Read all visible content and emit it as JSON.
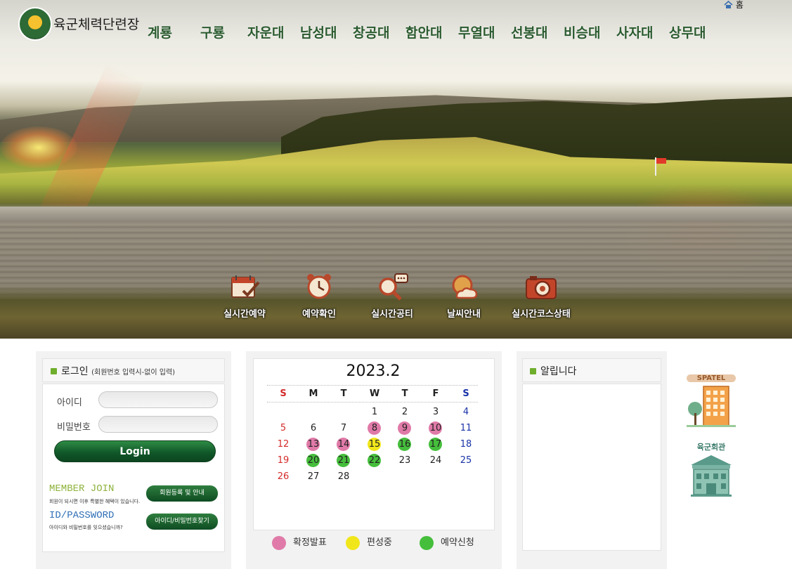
{
  "header": {
    "site_name": "육군체력단련장",
    "home_label": "홈",
    "nav": [
      "계룡",
      "구룡",
      "자운대",
      "남성대",
      "창공대",
      "함안대",
      "무열대",
      "선봉대",
      "비승대",
      "사자대",
      "상무대"
    ]
  },
  "quick_links": [
    {
      "label": "실시간예약",
      "icon": "calendar-check-icon"
    },
    {
      "label": "예약확인",
      "icon": "alarm-clock-icon"
    },
    {
      "label": "실시간공티",
      "icon": "search-chat-icon"
    },
    {
      "label": "날씨안내",
      "icon": "weather-icon"
    },
    {
      "label": "실시간코스상태",
      "icon": "camera-icon"
    }
  ],
  "login": {
    "title": "로그인",
    "subtitle": "(회원번호 입력시-없이 입력)",
    "id_label": "아이디",
    "pw_label": "비밀번호",
    "login_button": "Login",
    "member_join_title": "MEMBER JOIN",
    "member_join_desc": "회원이 되시면 이후 특별한 혜택이 있습니다.",
    "member_join_button": "회원등록 및 안내",
    "idpw_title": "ID/PASSWORD",
    "idpw_desc": "아이디와 비밀번호를 잊으셨습니까?",
    "idpw_button": "아이디/비밀번호찾기"
  },
  "calendar": {
    "title": "2023.2",
    "weekdays": [
      "S",
      "M",
      "T",
      "W",
      "T",
      "F",
      "S"
    ],
    "weeks": [
      [
        "",
        "",
        "",
        "1",
        "2",
        "3",
        "4"
      ],
      [
        "5",
        "6",
        "7",
        "8",
        "9",
        "10",
        "11"
      ],
      [
        "12",
        "13",
        "14",
        "15",
        "16",
        "17",
        "18"
      ],
      [
        "19",
        "20",
        "21",
        "22",
        "23",
        "24",
        "25"
      ],
      [
        "26",
        "27",
        "28",
        "",
        "",
        "",
        ""
      ]
    ],
    "marks": {
      "8": "confirmed",
      "9": "confirmed",
      "10": "confirmed",
      "13": "confirmed",
      "14": "confirmed",
      "15": "organizing",
      "16": "reservation",
      "17": "reservation",
      "20": "reservation",
      "21": "reservation",
      "22": "reservation"
    },
    "legend": [
      {
        "key": "confirmed",
        "label": "확정발표",
        "color": "#e07aa8"
      },
      {
        "key": "organizing",
        "label": "편성중",
        "color": "#f1e61a"
      },
      {
        "key": "reservation",
        "label": "예약신청",
        "color": "#45be3c"
      }
    ],
    "colors": {
      "sunday": "#d42a2a",
      "saturday": "#1a33a8",
      "weekday": "#222222"
    }
  },
  "notice": {
    "title": "알립니다"
  },
  "side_links": [
    {
      "label": "SPATEL",
      "icon": "hotel-building-icon"
    },
    {
      "label": "육군회관",
      "icon": "army-hall-icon"
    }
  ]
}
